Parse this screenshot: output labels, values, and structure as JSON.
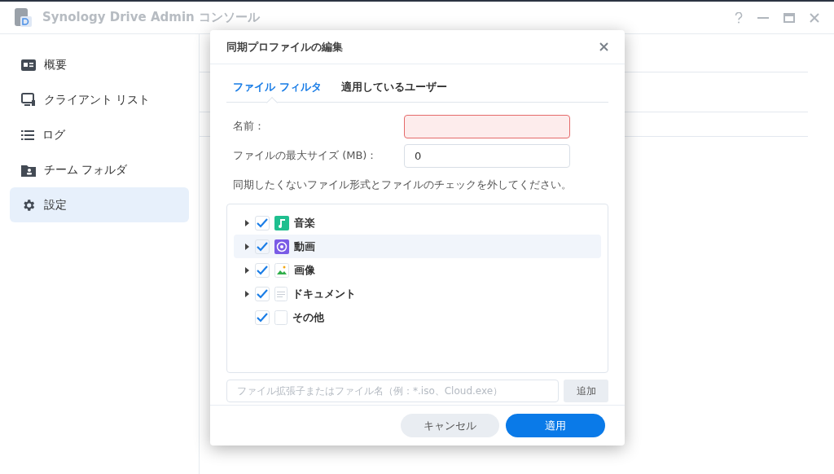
{
  "window": {
    "title": "Synology Drive Admin コンソール"
  },
  "sidebar": {
    "items": [
      {
        "label": "概要",
        "kind": "overview",
        "selected": false
      },
      {
        "label": "クライアント リスト",
        "kind": "clients",
        "selected": false
      },
      {
        "label": "ログ",
        "kind": "log",
        "selected": false
      },
      {
        "label": "チーム フォルダ",
        "kind": "team",
        "selected": false
      },
      {
        "label": "設定",
        "kind": "settings",
        "selected": true
      }
    ]
  },
  "dialog": {
    "title": "同期プロファイルの編集",
    "tabs": [
      {
        "label": "ファイル フィルタ",
        "selected": true
      },
      {
        "label": "適用しているユーザー",
        "selected": false
      }
    ],
    "fields": [
      {
        "label": "名前：",
        "invalid": true
      },
      {
        "label": "ファイルの最大サイズ (MB)：",
        "value": "0",
        "invalid": false
      }
    ],
    "instruction": "同期したくないファイル形式とファイルのチェックを外してください。",
    "tree": [
      {
        "label": "音楽",
        "kind": "music",
        "checked": true,
        "expandable": true,
        "selected": false
      },
      {
        "label": "動画",
        "kind": "video",
        "checked": true,
        "expandable": true,
        "selected": true
      },
      {
        "label": "画像",
        "kind": "image",
        "checked": true,
        "expandable": true,
        "selected": false
      },
      {
        "label": "ドキュメント",
        "kind": "document",
        "checked": true,
        "expandable": true,
        "selected": false
      },
      {
        "label": "その他",
        "kind": "other",
        "checked": true,
        "expandable": false,
        "selected": false
      }
    ],
    "add_field": {
      "placeholder": "ファイル拡張子またはファイル名（例：*.iso、Cloud.exe）"
    },
    "add_button": "追加",
    "buttons": [
      {
        "label": "キャンセル",
        "kind": "secondary"
      },
      {
        "label": "適用",
        "kind": "primary"
      }
    ]
  }
}
